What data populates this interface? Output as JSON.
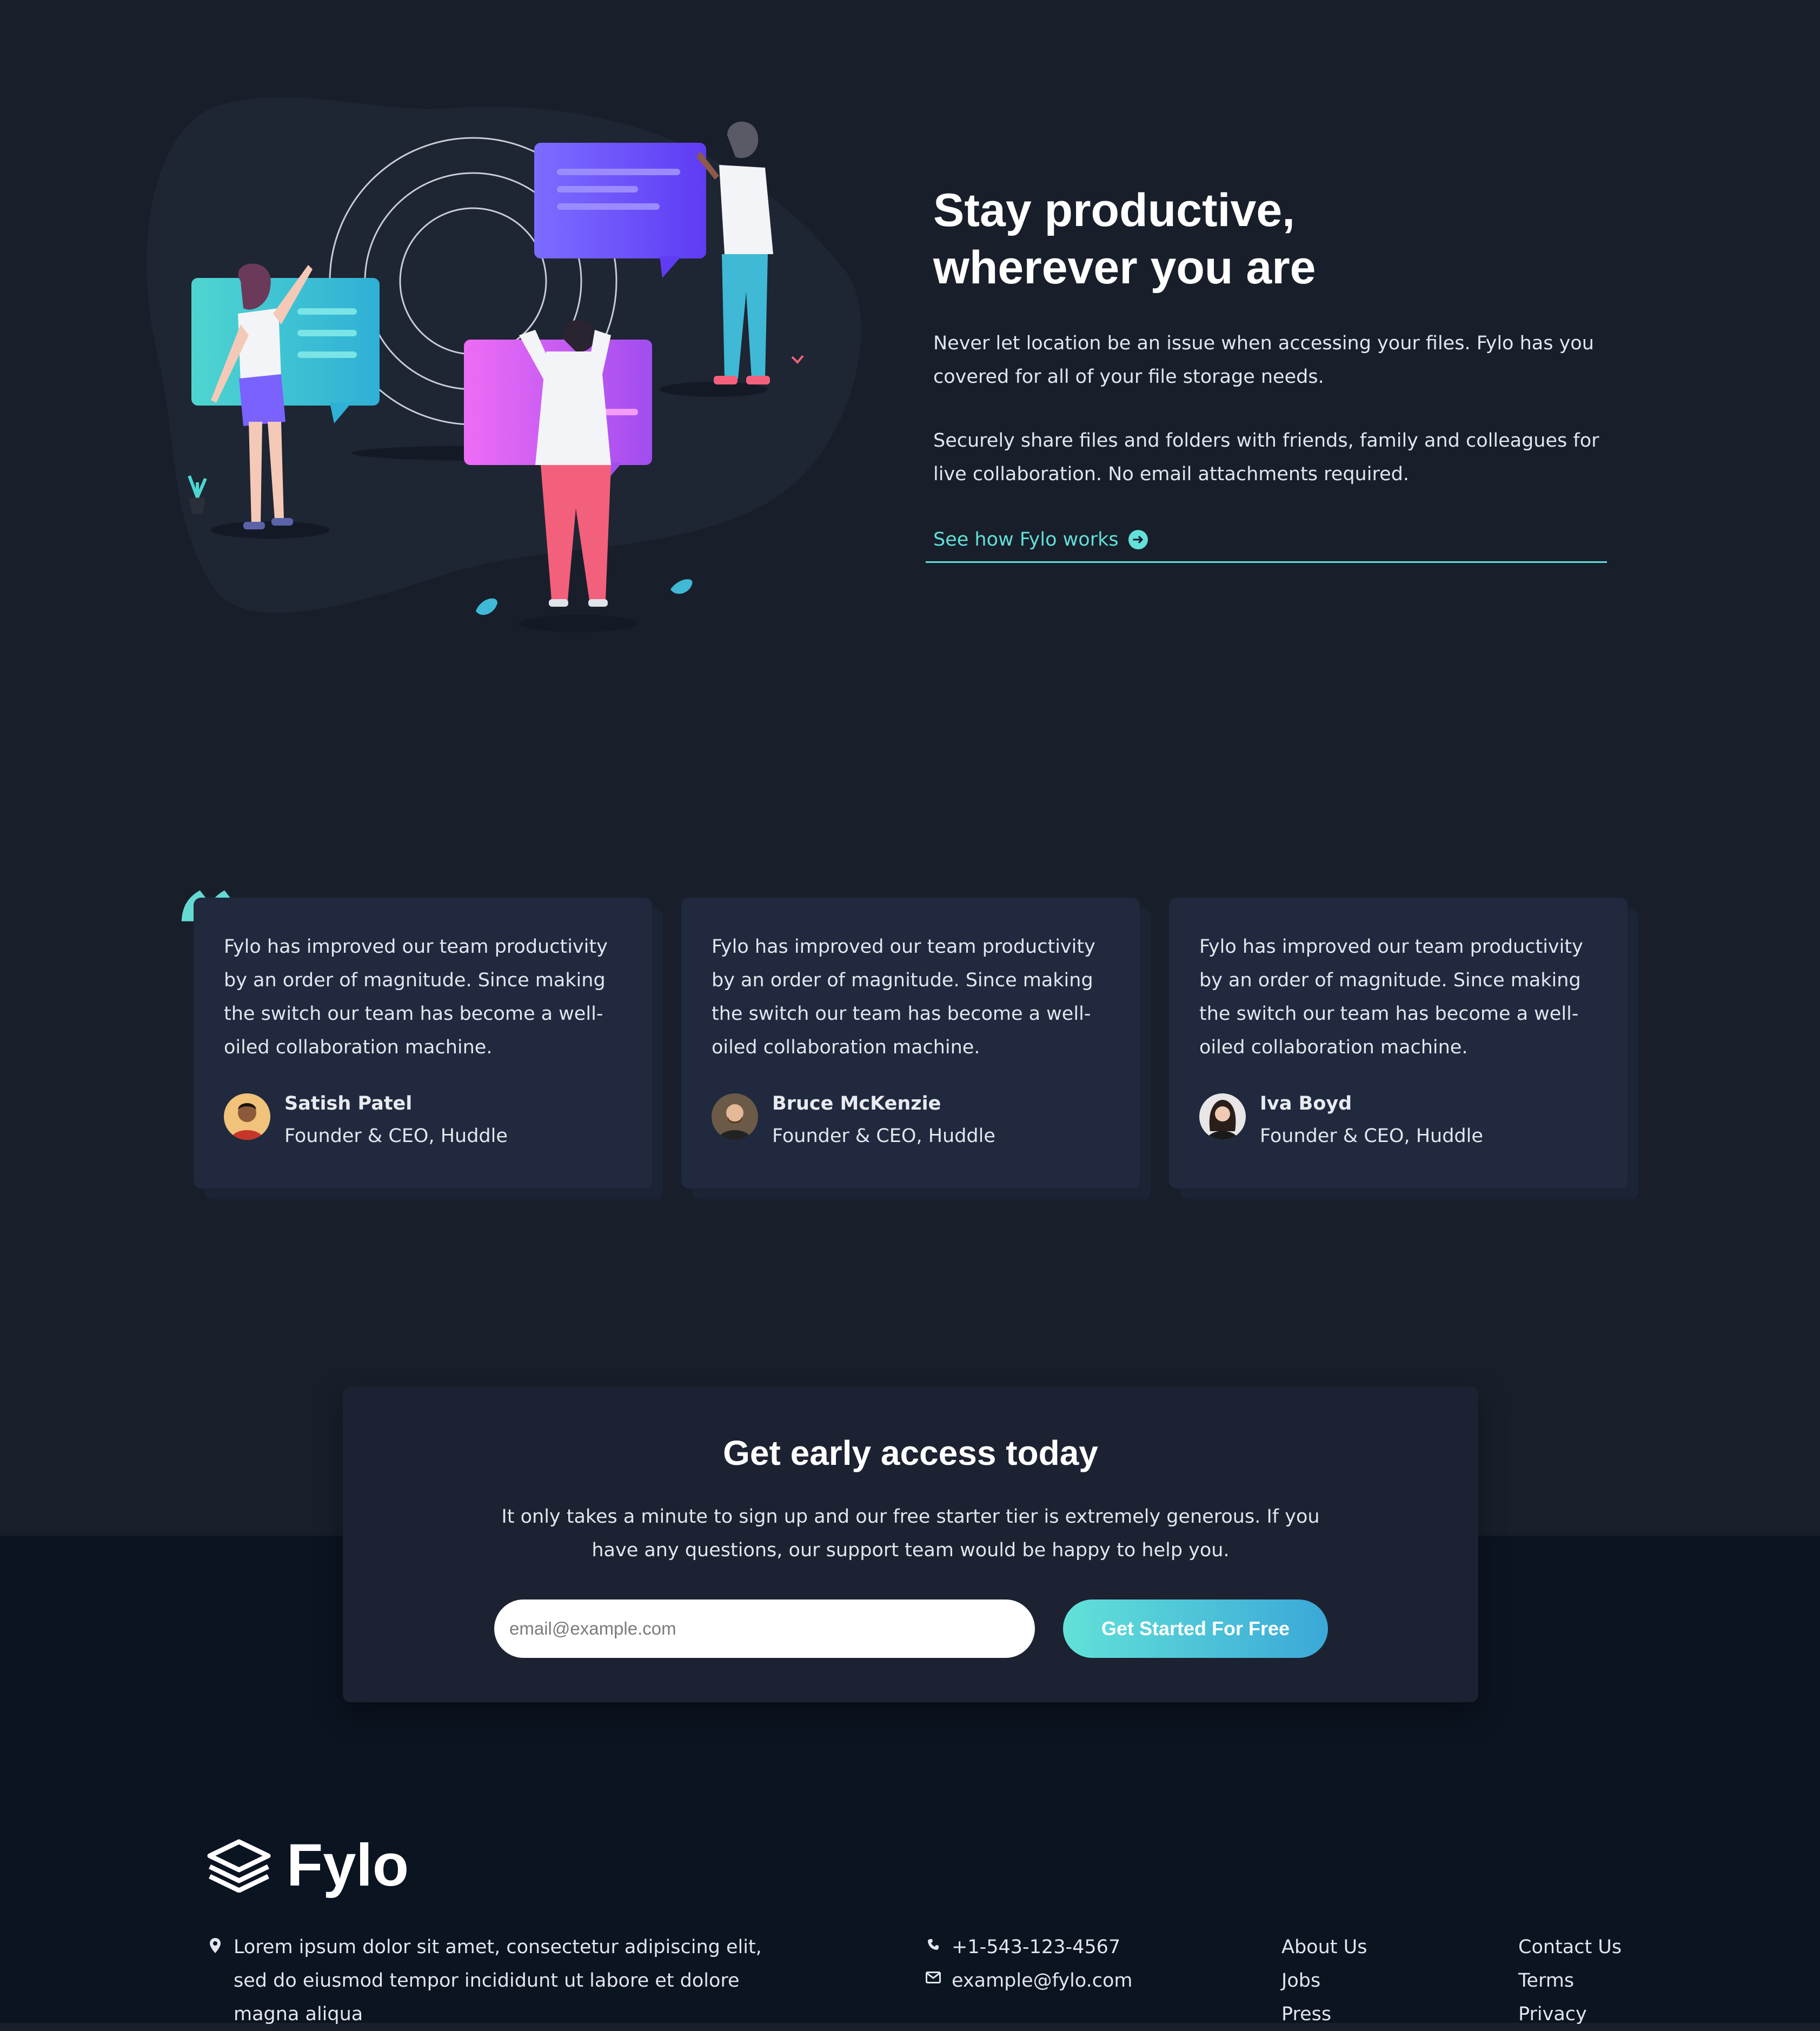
{
  "productive": {
    "title_line1": "Stay productive,",
    "title_line2": "wherever you are",
    "para1": "Never let location be an issue when accessing your files. Fylo has you covered for all of your file storage needs.",
    "para2": "Securely share files and folders with friends, family and colleagues for live collaboration. No email attachments required.",
    "link_label": "See how Fylo works"
  },
  "testimonials": [
    {
      "quote": "Fylo has improved our team productivity by an order of magnitude. Since making the switch our team has become a well-oiled collaboration machine.",
      "name": "Satish Patel",
      "role": "Founder & CEO, Huddle"
    },
    {
      "quote": "Fylo has improved our team productivity by an order of magnitude. Since making the switch our team has become a well-oiled collaboration machine.",
      "name": "Bruce McKenzie",
      "role": "Founder & CEO, Huddle"
    },
    {
      "quote": "Fylo has improved our team productivity by an order of magnitude. Since making the switch our team has become a well-oiled collaboration machine.",
      "name": "Iva Boyd",
      "role": "Founder & CEO, Huddle"
    }
  ],
  "cta": {
    "title": "Get early access today",
    "text": "It only takes a minute to sign up and our free starter tier is extremely generous. If you have any questions, our support team would be happy to help you.",
    "email_placeholder": "email@example.com",
    "button_label": "Get Started For Free"
  },
  "footer": {
    "logo_text": "Fylo",
    "address": "Lorem ipsum dolor sit amet, consectetur adipiscing elit, sed do eiusmod tempor incididunt ut labore et dolore magna aliqua",
    "phone": "+1-543-123-4567",
    "email": "example@fylo.com",
    "links_col1": [
      "About Us",
      "Jobs",
      "Press"
    ],
    "links_col2": [
      "Contact Us",
      "Terms",
      "Privacy"
    ]
  },
  "colors": {
    "background": "#181f2a",
    "footer_background": "#0b1421",
    "card": "#20293d",
    "accent": "#62e0d9",
    "button_gradient_end": "#3aa8d8"
  },
  "icons": [
    "arrow-circle-icon",
    "quote-icon",
    "location-icon",
    "phone-icon",
    "email-icon",
    "fylo-logo-icon"
  ]
}
